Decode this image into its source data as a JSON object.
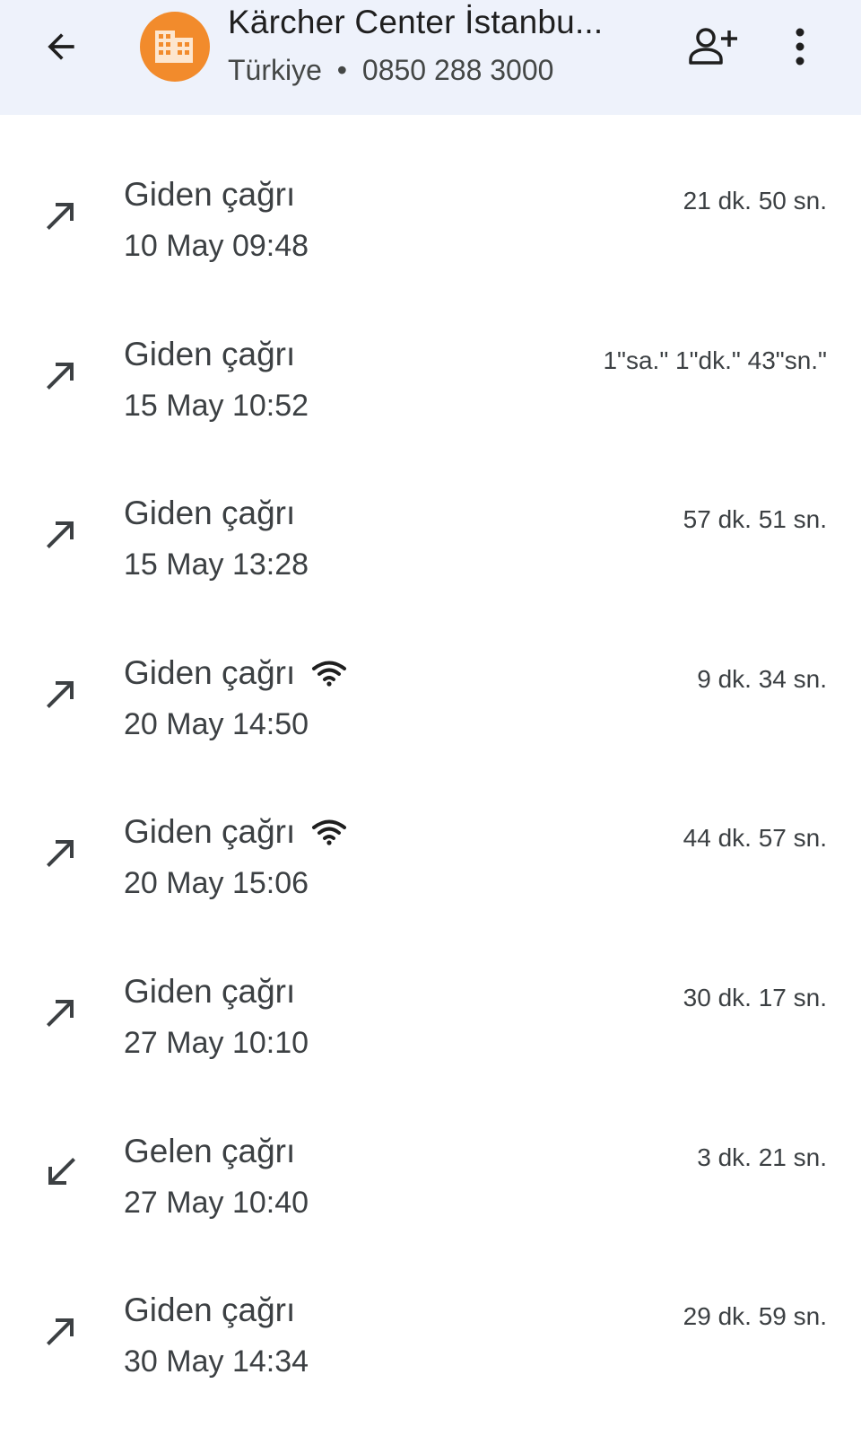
{
  "header": {
    "title": "Kärcher Center İstanbu...",
    "country": "Türkiye",
    "separator": "•",
    "phone": "0850 288 3000",
    "avatar_icon": "building-icon",
    "avatar_color": "#f28b2c",
    "back_icon": "arrow-back-icon",
    "add_contact_icon": "person-add-icon",
    "more_icon": "more-vert-icon"
  },
  "calls": [
    {
      "type": "Giden çağrı",
      "direction": "outgoing",
      "wifi": false,
      "time": "10 May 09:48",
      "duration": "21 dk. 50 sn."
    },
    {
      "type": "Giden çağrı",
      "direction": "outgoing",
      "wifi": false,
      "time": "15 May 10:52",
      "duration": "1\"sa.\" 1\"dk.\" 43\"sn.\""
    },
    {
      "type": "Giden çağrı",
      "direction": "outgoing",
      "wifi": false,
      "time": "15 May 13:28",
      "duration": "57 dk. 51 sn."
    },
    {
      "type": "Giden çağrı",
      "direction": "outgoing",
      "wifi": true,
      "time": "20 May 14:50",
      "duration": "9 dk. 34 sn."
    },
    {
      "type": "Giden çağrı",
      "direction": "outgoing",
      "wifi": true,
      "time": "20 May 15:06",
      "duration": "44 dk. 57 sn."
    },
    {
      "type": "Giden çağrı",
      "direction": "outgoing",
      "wifi": false,
      "time": "27 May 10:10",
      "duration": "30 dk. 17 sn."
    },
    {
      "type": "Gelen çağrı",
      "direction": "incoming",
      "wifi": false,
      "time": "27 May 10:40",
      "duration": "3 dk. 21 sn."
    },
    {
      "type": "Giden çağrı",
      "direction": "outgoing",
      "wifi": false,
      "time": "30 May 14:34",
      "duration": "29 dk. 59 sn."
    }
  ]
}
